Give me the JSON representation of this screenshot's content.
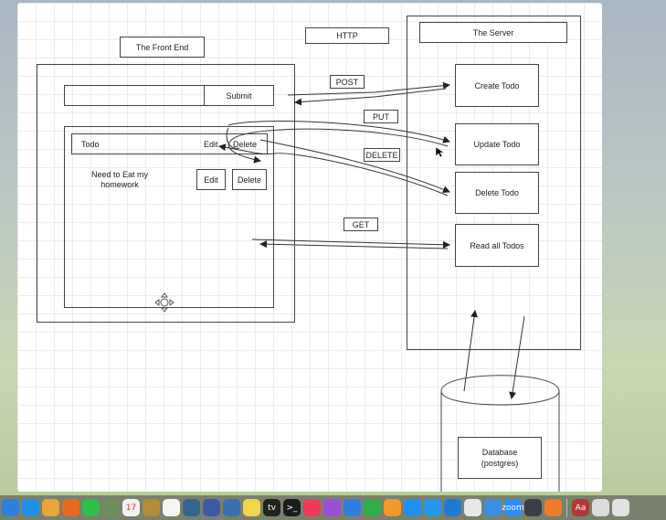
{
  "diagram": {
    "front_end_title": "The Front End",
    "http_label": "HTTP",
    "server_title": "The Server",
    "submit_label": "Submit",
    "todo_label": "Todo",
    "edit_label": "Edit",
    "delete_label": "Delete",
    "todo_item_text": "Need to Eat my homework",
    "item_edit_label": "Edit",
    "item_delete_label": "Delete",
    "post_label": "POST",
    "put_label": "PUT",
    "delete_method_label": "DELETE",
    "get_label": "GET",
    "create_todo": "Create Todo",
    "update_todo": "Update Todo",
    "delete_todo": "Delete Todo",
    "read_todos": "Read all Todos",
    "database_label": "Database (postgres)"
  },
  "dock": {
    "apps": [
      {
        "name": "finder-icon",
        "color": "#2d7fe0"
      },
      {
        "name": "safari-icon",
        "color": "#1f8fe6"
      },
      {
        "name": "photos-icon",
        "color": "#e9a43a"
      },
      {
        "name": "firefox-icon",
        "color": "#e66a1f"
      },
      {
        "name": "facetime-icon",
        "color": "#2fbf4a"
      },
      {
        "name": "preview-icon",
        "color": "#6b8e5a"
      },
      {
        "name": "calendar-icon",
        "color": "#f2f2f2",
        "text": "17"
      },
      {
        "name": "notes-icon",
        "color": "#b58a3a"
      },
      {
        "name": "reminders-icon",
        "color": "#f5f5f5"
      },
      {
        "name": "postgres-icon",
        "color": "#336791"
      },
      {
        "name": "tableplus-icon",
        "color": "#3b5ba5"
      },
      {
        "name": "quicktime-icon",
        "color": "#3a6fb0"
      },
      {
        "name": "stickies-icon",
        "color": "#f3d54a"
      },
      {
        "name": "appletv-icon",
        "color": "#222222",
        "text": "tv"
      },
      {
        "name": "terminal-icon",
        "color": "#1c1c1c",
        "text": ">_"
      },
      {
        "name": "music-icon",
        "color": "#f03a57"
      },
      {
        "name": "podcasts-icon",
        "color": "#9b4fd6"
      },
      {
        "name": "keynote-icon",
        "color": "#2f7ee0"
      },
      {
        "name": "numbers-icon",
        "color": "#2fae4a"
      },
      {
        "name": "pages-icon",
        "color": "#f09a2a"
      },
      {
        "name": "appstore-icon",
        "color": "#1f8ff0"
      },
      {
        "name": "docker-icon",
        "color": "#2496ed"
      },
      {
        "name": "vscode-icon",
        "color": "#1f7ad6"
      },
      {
        "name": "chrome-icon",
        "color": "#e8e8e8"
      },
      {
        "name": "xcode-icon",
        "color": "#3a8fe0"
      },
      {
        "name": "zoom-icon",
        "color": "#2d8cff",
        "text": "zoom"
      },
      {
        "name": "atom-icon",
        "color": "#3a3f4a"
      },
      {
        "name": "sublime-icon",
        "color": "#f07a2a"
      },
      {
        "name": "dictionary-icon",
        "color": "#b0393a",
        "text": "Aa"
      },
      {
        "name": "downloads-icon",
        "color": "#dcdcdc"
      },
      {
        "name": "trash-icon",
        "color": "#e2e2e2"
      }
    ]
  }
}
